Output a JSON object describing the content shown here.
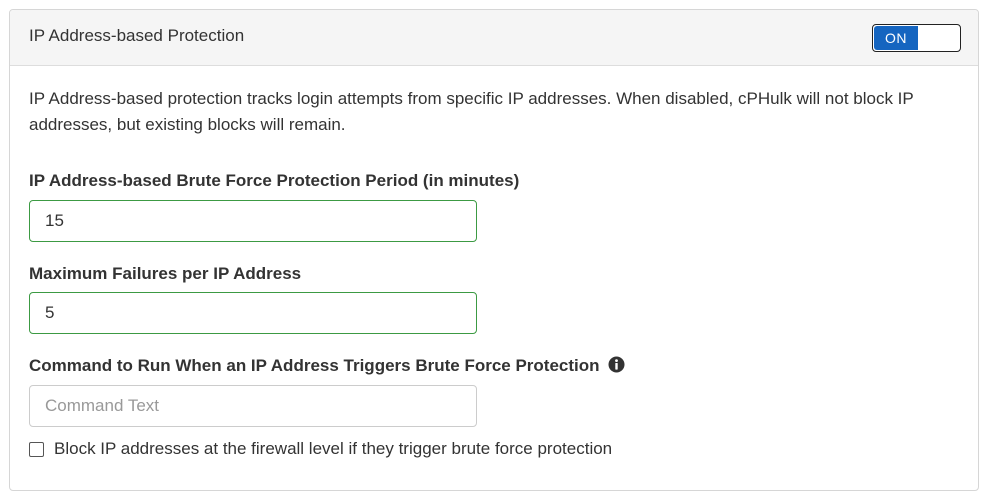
{
  "panel": {
    "title": "IP Address-based Protection",
    "toggle": {
      "state_label": "ON",
      "on_color": "#1565c0"
    },
    "description": "IP Address-based protection tracks login attempts from specific IP addresses. When disabled, cPHulk will not block IP addresses, but existing blocks will remain."
  },
  "fields": {
    "protection_period": {
      "label": "IP Address-based Brute Force Protection Period (in minutes)",
      "value": "15"
    },
    "max_failures": {
      "label": "Maximum Failures per IP Address",
      "value": "5"
    },
    "command": {
      "label": "Command to Run When an IP Address Triggers Brute Force Protection",
      "value": "",
      "placeholder": "Command Text",
      "icon": "info-icon"
    },
    "firewall_block": {
      "label": "Block IP addresses at the firewall level if they trigger brute force protection",
      "checked": false
    }
  },
  "colors": {
    "valid_border": "#3c9a43",
    "header_bg": "#f5f5f5"
  }
}
